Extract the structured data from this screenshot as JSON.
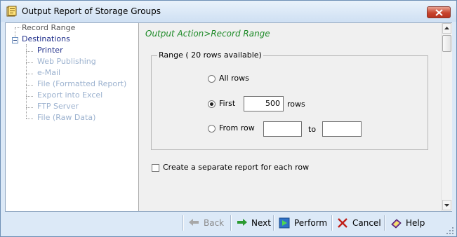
{
  "window": {
    "title": "Output Report of Storage Groups"
  },
  "tree": {
    "record_range": "Record Range",
    "destinations": "Destinations",
    "items": [
      {
        "label": "Printer"
      },
      {
        "label": "Web Publishing"
      },
      {
        "label": "e-Mail"
      },
      {
        "label": "File (Formatted Report)"
      },
      {
        "label": "Export into Excel"
      },
      {
        "label": "FTP Server"
      },
      {
        "label": "File (Raw Data)"
      }
    ]
  },
  "panel": {
    "heading": "Output Action>Record Range",
    "range": {
      "label": "Range ( 20 rows available)",
      "all_rows": "All rows",
      "first": "First",
      "first_value": "500",
      "rows": "rows",
      "from_row": "From row",
      "from_value": "",
      "to": "to",
      "to_value": "",
      "selected": "first"
    },
    "separate_report": {
      "label": "Create a separate report for each row",
      "checked": false
    }
  },
  "toolbar": {
    "back": "Back",
    "next": "Next",
    "perform": "Perform",
    "cancel": "Cancel",
    "help": "Help"
  },
  "colors": {
    "heading": "#1d8a27",
    "selected_item": "#1f2e8a",
    "disabled_item": "#9cb2cf"
  }
}
